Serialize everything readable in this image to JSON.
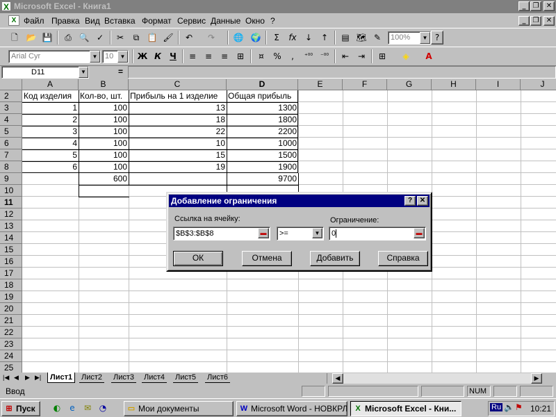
{
  "window": {
    "title": "Microsoft Excel - Книга1"
  },
  "menu": [
    "Файл",
    "Правка",
    "Вид",
    "Вставка",
    "Формат",
    "Сервис",
    "Данные",
    "Окно",
    "?"
  ],
  "toolbar": {
    "zoom": "100%",
    "font": "Arial Cyr",
    "font_size": "10",
    "bold": "Ж",
    "italic": "К",
    "underline": "Ч",
    "percent": "%",
    "comma": ",",
    "sigma": "Σ",
    "fx": "fx"
  },
  "formula_bar": {
    "name_box": "D11",
    "equals": "="
  },
  "grid": {
    "columns": [
      "A",
      "B",
      "C",
      "D",
      "E",
      "F",
      "G",
      "H",
      "I",
      "J"
    ],
    "rows": [
      "2",
      "3",
      "4",
      "5",
      "6",
      "7",
      "8",
      "9",
      "10",
      "11",
      "12",
      "13",
      "14",
      "15",
      "16",
      "17",
      "18",
      "19",
      "20",
      "21",
      "22",
      "23",
      "24",
      "25"
    ],
    "header": [
      "Код изделия",
      "Кол-во, шт.",
      "Прибыль на 1 изделие",
      "Общая прибыль"
    ],
    "data": [
      [
        "1",
        "100",
        "13",
        "1300"
      ],
      [
        "2",
        "100",
        "18",
        "1800"
      ],
      [
        "3",
        "100",
        "22",
        "2200"
      ],
      [
        "4",
        "100",
        "10",
        "1000"
      ],
      [
        "5",
        "100",
        "15",
        "1500"
      ],
      [
        "6",
        "100",
        "19",
        "1900"
      ]
    ],
    "totals": {
      "B": "600",
      "D": "9700"
    }
  },
  "dialog": {
    "title": "Добавление ограничения",
    "help_btn": "?",
    "close_btn": "✕",
    "ref_label": "Ссылка на ячейку:",
    "ref_value": "$B$3:$B$8",
    "operator": ">=",
    "constraint_label": "Ограничение:",
    "constraint_value": "0",
    "ok": "ОК",
    "cancel": "Отмена",
    "add": "Добавить",
    "help": "Справка"
  },
  "sheets": [
    "Лист1",
    "Лист2",
    "Лист3",
    "Лист4",
    "Лист5",
    "Лист6"
  ],
  "active_sheet": "Лист1",
  "status": {
    "mode": "Ввод",
    "num": "NUM"
  },
  "taskbar": {
    "start": "Пуск",
    "tasks": [
      "Мои документы",
      "Microsoft Word - НОВКРЛ...",
      "Microsoft Excel - Кни..."
    ],
    "lang": "Ru",
    "clock": "10:21"
  }
}
